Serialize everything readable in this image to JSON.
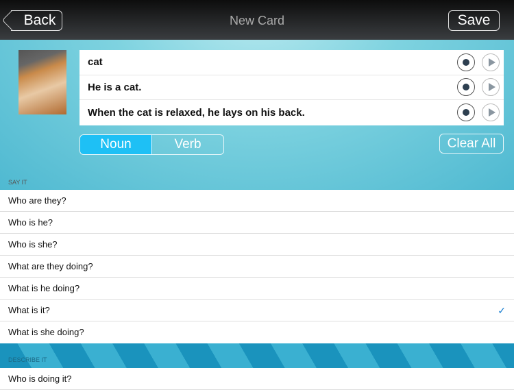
{
  "nav": {
    "back": "Back",
    "title": "New Card",
    "save": "Save"
  },
  "fields": [
    {
      "text": "cat"
    },
    {
      "text": "He is a cat."
    },
    {
      "text": "When the cat is relaxed, he lays on his back."
    }
  ],
  "segment": {
    "noun": "Noun",
    "verb": "Verb",
    "selected": "Noun"
  },
  "clear_all": "Clear All",
  "sections": [
    {
      "header": "SAY IT",
      "items": [
        "Who are they?",
        "Who is he?",
        "Who is she?",
        "What are they doing?",
        "What is he doing?",
        "What is it?",
        "What is she doing?"
      ],
      "checked": "What is it?"
    },
    {
      "header": "DESCRIBE IT",
      "items": [
        "Who is doing it?"
      ]
    }
  ],
  "check_glyph": "✓"
}
